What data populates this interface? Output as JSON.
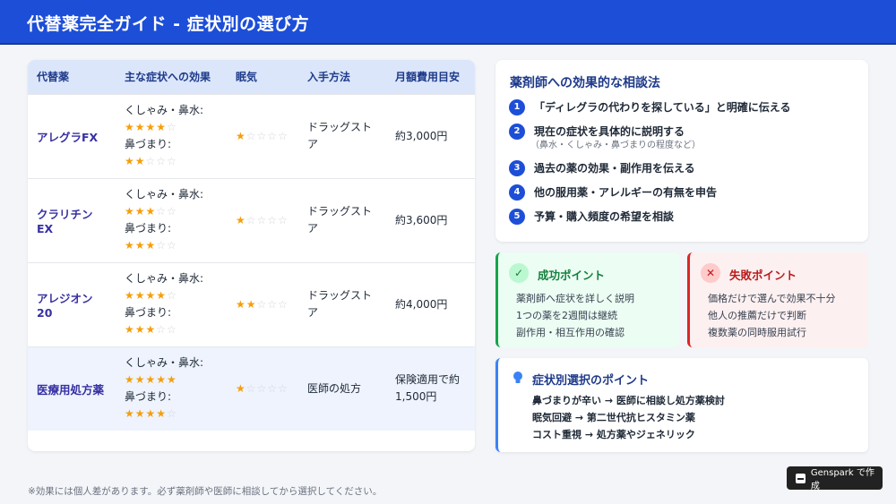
{
  "header": {
    "title": "代替薬完全ガイド - 症状別の選び方"
  },
  "table": {
    "columns": [
      "代替薬",
      "主な症状への効果",
      "眠気",
      "入手方法",
      "月額費用目安"
    ],
    "rows": [
      {
        "name": "アレグラFX",
        "sym1_label": "くしゃみ・鼻水:",
        "sym1_stars": 4,
        "sym2_label": "鼻づまり:",
        "sym2_stars": 2,
        "drowsiness_stars": 1,
        "source": "ドラッグストア",
        "cost": "約3,000円",
        "highlight": false
      },
      {
        "name": "クラリチンEX",
        "sym1_label": "くしゃみ・鼻水:",
        "sym1_stars": 3,
        "sym2_label": "鼻づまり:",
        "sym2_stars": 3,
        "drowsiness_stars": 1,
        "source": "ドラッグストア",
        "cost": "約3,600円",
        "highlight": false
      },
      {
        "name": "アレジオン20",
        "sym1_label": "くしゃみ・鼻水:",
        "sym1_stars": 4,
        "sym2_label": "鼻づまり:",
        "sym2_stars": 3,
        "drowsiness_stars": 2,
        "source": "ドラッグストア",
        "cost": "約4,000円",
        "highlight": false
      },
      {
        "name": "医療用処方薬",
        "sym1_label": "くしゃみ・鼻水:",
        "sym1_stars": 5,
        "sym2_label": "鼻づまり:",
        "sym2_stars": 4,
        "drowsiness_stars": 1,
        "source": "医師の処方",
        "cost": "保険適用で約1,500円",
        "highlight": true
      }
    ],
    "max_stars": 5
  },
  "consult": {
    "title": "薬剤師への効果的な相談法",
    "steps": [
      {
        "num": "1",
        "text": "「ディレグラの代わりを探している」と明確に伝える",
        "sub": ""
      },
      {
        "num": "2",
        "text": "現在の症状を具体的に説明する",
        "sub": "（鼻水・くしゃみ・鼻づまりの程度など）"
      },
      {
        "num": "3",
        "text": "過去の薬の効果・副作用を伝える",
        "sub": ""
      },
      {
        "num": "4",
        "text": "他の服用薬・アレルギーの有無を申告",
        "sub": ""
      },
      {
        "num": "5",
        "text": "予算・購入頻度の希望を相談",
        "sub": ""
      }
    ]
  },
  "success": {
    "icon": "check-icon",
    "title": "成功ポイント",
    "items": [
      "薬剤師へ症状を詳しく説明",
      "1つの薬を2週間は継続",
      "副作用・相互作用の確認"
    ]
  },
  "fail": {
    "icon": "x-icon",
    "title": "失敗ポイント",
    "items": [
      "価格だけで選んで効果不十分",
      "他人の推薦だけで判断",
      "複数薬の同時服用試行"
    ]
  },
  "tips": {
    "icon": "lightbulb-icon",
    "title": "症状別選択のポイント",
    "items": [
      "鼻づまりが辛い → 医師に相談し処方薬検討",
      "眠気回避 → 第二世代抗ヒスタミン薬",
      "コスト重視 → 処方薬やジェネリック"
    ]
  },
  "footnote": "※効果には個人差があります。必ず薬剤師や医師に相談してから選択してください。",
  "badge": {
    "text": "Genspark で作成"
  },
  "colors": {
    "header": "#1d4ed8",
    "star": "#f59e0b",
    "success": "#16a34a",
    "fail": "#dc2626",
    "accent": "#3b82f6"
  }
}
